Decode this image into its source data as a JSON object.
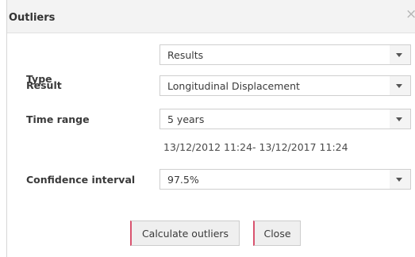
{
  "dialog": {
    "title": "Outliers",
    "close_symbol": "×"
  },
  "form": {
    "type": {
      "label": "Type",
      "value": "Results"
    },
    "result": {
      "label": "Result",
      "value": "Longitudinal Displacement"
    },
    "time_range": {
      "label": "Time range",
      "value": "5 years",
      "range_text": "13/12/2012 11:24- 13/12/2017 11:24"
    },
    "confidence": {
      "label": "Confidence interval",
      "value": "97.5%"
    }
  },
  "buttons": {
    "calculate_label": "Calculate outliers",
    "close_label": "Close"
  },
  "colors": {
    "button_accent": "#d9536f",
    "titlebar_bg": "#f3f3f3"
  },
  "icons": {
    "close": "close-icon",
    "dropdown": "chevron-down-icon"
  }
}
